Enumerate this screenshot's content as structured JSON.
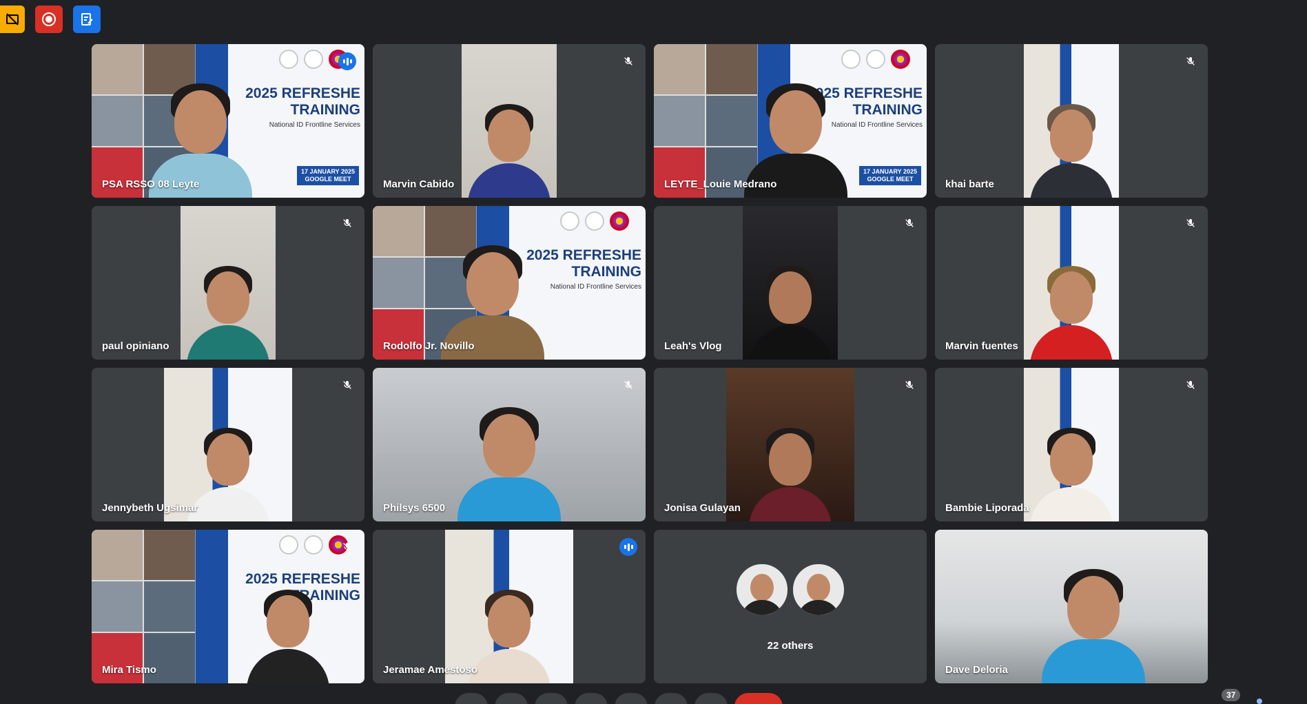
{
  "top_icons": [
    {
      "name": "captions-off-icon",
      "color": "#f9ab00"
    },
    {
      "name": "recording-icon",
      "color": "#d93025"
    },
    {
      "name": "notes-icon",
      "color": "#1a73e8"
    }
  ],
  "tiles": [
    {
      "name": "PSA RSSO 08 Leyte",
      "bg": "poster",
      "status": "speaking"
    },
    {
      "name": "Marvin Cabido",
      "bg": "wall",
      "status": "muted"
    },
    {
      "name": "LEYTE_Louie Medrano",
      "bg": "poster",
      "status": "none"
    },
    {
      "name": "khai barte",
      "bg": "poster-narrow",
      "status": "muted"
    },
    {
      "name": "paul opiniano",
      "bg": "wall",
      "status": "muted"
    },
    {
      "name": "Rodolfo Jr. Novillo",
      "bg": "poster",
      "status": "none"
    },
    {
      "name": "Leah's Vlog",
      "bg": "dark",
      "status": "muted"
    },
    {
      "name": "Marvin fuentes",
      "bg": "poster-narrow",
      "status": "muted"
    },
    {
      "name": "Jennybeth Ugsimar",
      "bg": "poster-narrow",
      "status": "muted"
    },
    {
      "name": "Philsys 6500",
      "bg": "room",
      "status": "muted"
    },
    {
      "name": "Jonisa Gulayan",
      "bg": "dark",
      "status": "muted"
    },
    {
      "name": "Bambie Liporada",
      "bg": "poster-narrow",
      "status": "muted"
    },
    {
      "name": "Mira Tismo",
      "bg": "poster",
      "status": "muted"
    },
    {
      "name": "Jeramae Amestoso",
      "bg": "poster-narrow",
      "status": "speaking"
    },
    {
      "name": "22 others",
      "bg": "others",
      "status": "none"
    },
    {
      "name": "Dave Deloria",
      "bg": "office",
      "status": "none"
    }
  ],
  "poster": {
    "title_line1": "2025 REFRESHE",
    "title_line2": "TRAINING",
    "subtitle": "National ID Frontline Services",
    "date_line1": "17 JANUARY 2025",
    "date_line2": "GOOGLE MEET"
  },
  "others": {
    "label": "22 others"
  },
  "participant_count": "37"
}
